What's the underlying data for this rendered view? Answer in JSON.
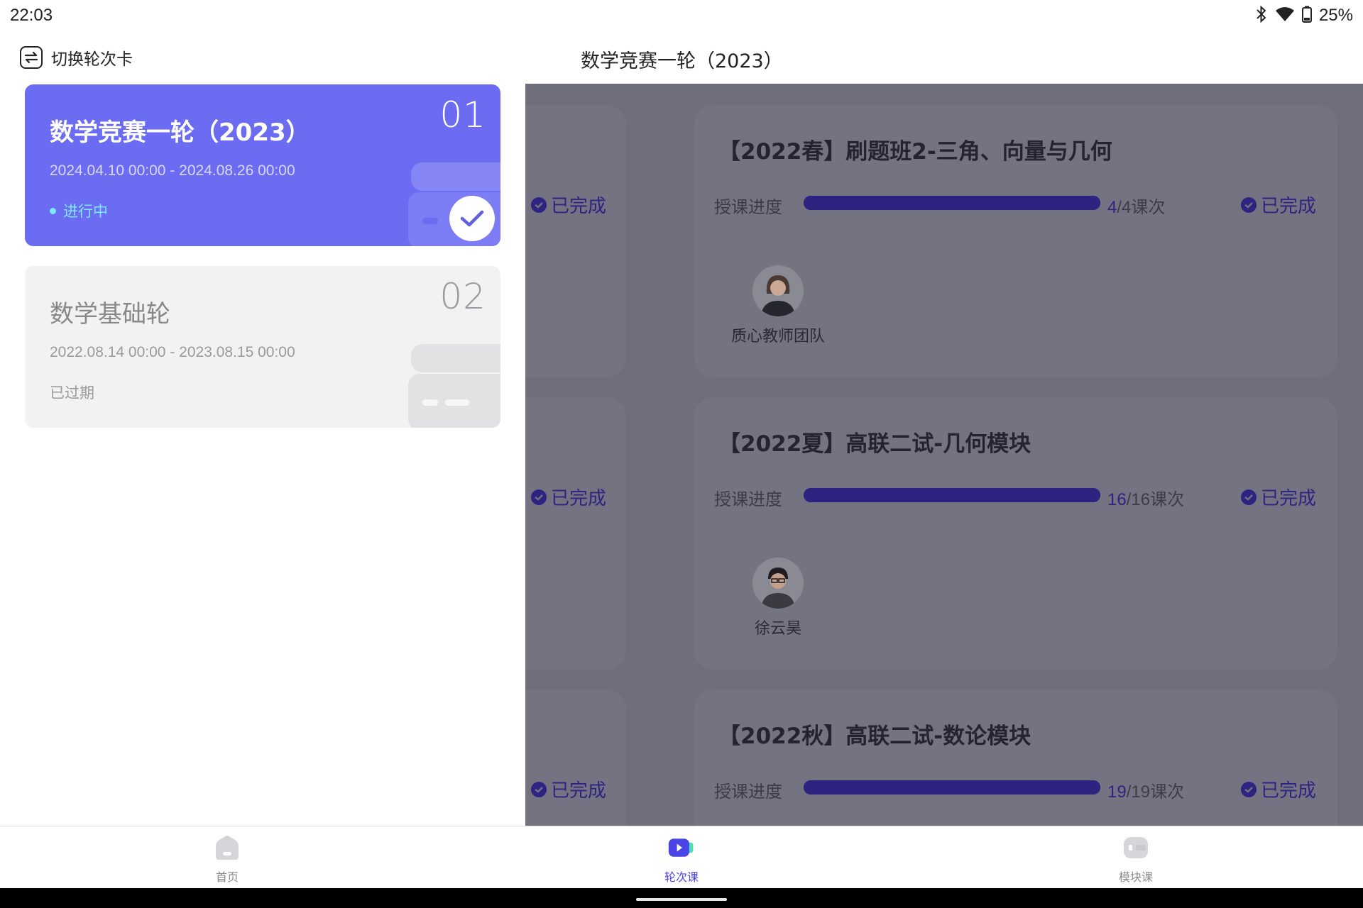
{
  "status_bar": {
    "time": "22:03",
    "battery": "25%",
    "icons": [
      "bluetooth-icon",
      "wifi-icon",
      "battery-icon"
    ]
  },
  "header": {
    "switch_label": "切换轮次卡",
    "switch_icon": "switch-icon",
    "title": "数学竞赛一轮（2023）"
  },
  "round_cards": [
    {
      "number": "01",
      "title": "数学竞赛一轮（2023）",
      "date_range": "2024.04.10 00:00 - 2024.08.26 00:00",
      "status": "进行中",
      "selected": true
    },
    {
      "number": "02",
      "title": "数学基础轮",
      "date_range": "2022.08.14 00:00 - 2023.08.15 00:00",
      "status": "已过期",
      "selected": false
    }
  ],
  "courses": {
    "progress_label": "授课进度",
    "done_label": "已完成",
    "items": [
      {
        "title": "【2022春】刷题班2-三角、向量与几何",
        "done": "4",
        "total": "/4课次",
        "progress": 1.0,
        "teacher": "质心教师团队"
      },
      {
        "title": "【2022夏】高联二试-几何模块",
        "done": "16",
        "total": "/16课次",
        "progress": 1.0,
        "teacher": "徐云昊"
      },
      {
        "title": "【2022秋】高联二试-数论模块",
        "done": "19",
        "total": "/19课次",
        "progress": 1.0,
        "teacher": ""
      }
    ]
  },
  "bottom_nav": {
    "items": [
      {
        "label": "首页",
        "icon": "home-icon",
        "active": false
      },
      {
        "label": "轮次课",
        "icon": "video-icon",
        "active": true
      },
      {
        "label": "模块课",
        "icon": "module-icon",
        "active": false
      }
    ]
  },
  "colors": {
    "accent": "#6c6cf2",
    "active_status": "#7ee8ff",
    "overlay": "#6e6e7c",
    "progress": "#2c2480",
    "nav_active": "#4b44e6"
  }
}
